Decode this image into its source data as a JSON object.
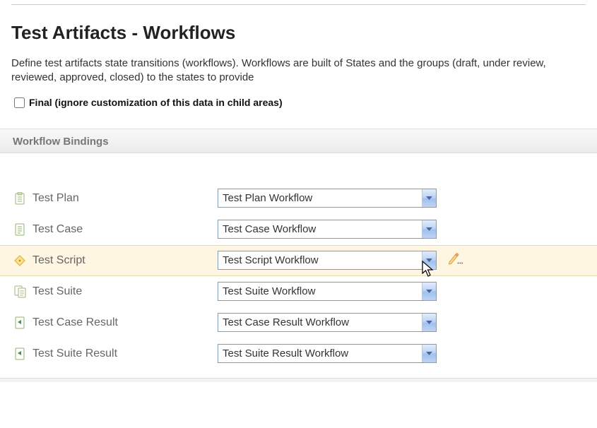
{
  "page": {
    "title": "Test Artifacts - Workflows",
    "description": "Define test artifacts state transitions (workflows). Workflows are built of States and the groups (draft, under review, reviewed, approved, closed) to the states to provide",
    "finalCheckboxLabel": "Final (ignore customization of this data in child areas)"
  },
  "section": {
    "header": "Workflow Bindings"
  },
  "bindings": [
    {
      "icon": "clipboard-icon",
      "label": "Test Plan",
      "value": "Test Plan Workflow",
      "selected": false,
      "editVisible": false
    },
    {
      "icon": "case-icon",
      "label": "Test Case",
      "value": "Test Case Workflow",
      "selected": false,
      "editVisible": false
    },
    {
      "icon": "script-icon",
      "label": "Test Script",
      "value": "Test Script Workflow",
      "selected": true,
      "editVisible": true
    },
    {
      "icon": "suite-icon",
      "label": "Test Suite",
      "value": "Test Suite Workflow",
      "selected": false,
      "editVisible": false
    },
    {
      "icon": "result-icon",
      "label": "Test Case Result",
      "value": "Test Case Result Workflow",
      "selected": false,
      "editVisible": false
    },
    {
      "icon": "result-icon",
      "label": "Test Suite Result",
      "value": "Test Suite Result Workflow",
      "selected": false,
      "editVisible": false
    }
  ]
}
